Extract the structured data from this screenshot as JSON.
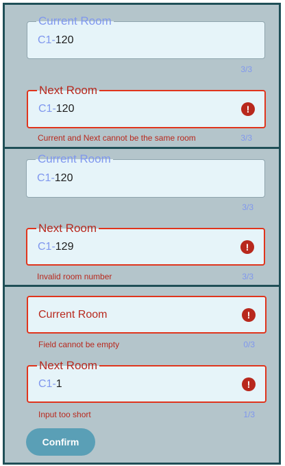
{
  "panels": [
    {
      "current": {
        "label": "Current Room",
        "prefix": "C1-",
        "value": "120",
        "counter": "3/3"
      },
      "next": {
        "label": "Next Room",
        "prefix": "C1-",
        "value": "120",
        "error": "Current and Next cannot be the same room",
        "counter": "3/3",
        "error_icon": "!"
      }
    },
    {
      "current": {
        "label": "Current Room",
        "prefix": "C1-",
        "value": "120",
        "counter": "3/3"
      },
      "next": {
        "label": "Next Room",
        "prefix": "C1-",
        "value": "129",
        "error": "Invalid room number",
        "counter": "3/3",
        "error_icon": "!"
      }
    },
    {
      "current": {
        "placeholder": "Current Room",
        "error": "Field cannot be empty",
        "counter": "0/3",
        "error_icon": "!"
      },
      "next": {
        "label": "Next Room",
        "prefix": "C1-",
        "value": "1",
        "error": "Input too short",
        "counter": "1/3",
        "error_icon": "!"
      }
    }
  ],
  "confirm_label": "Confirm",
  "colors": {
    "panel_bg": "#b4c5cb",
    "panel_border": "#1f4f57",
    "field_bg": "#e6f4f9",
    "accent_blue": "#7f97ee",
    "error_red": "#b8281d",
    "error_border": "#e0341c",
    "button_bg": "#5a9fb6"
  }
}
